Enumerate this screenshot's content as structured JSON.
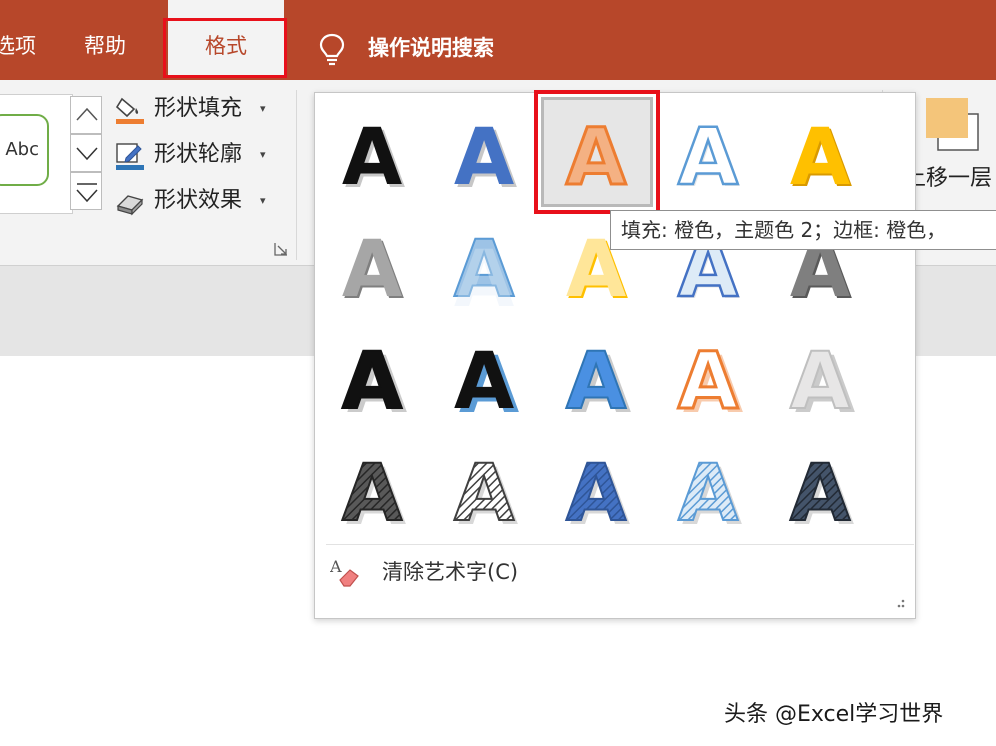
{
  "tabs": {
    "partial_label": "选项",
    "help_label": "帮助",
    "format_label": "格式",
    "tell_me_label": "操作说明搜索"
  },
  "ribbon": {
    "shape_style_sample": "Abc",
    "shape_fill_label": "形状填充",
    "shape_outline_label": "形状轮廓",
    "shape_effects_label": "形状效果",
    "caret": "▾",
    "bring_forward_label": "上移一层",
    "bring_forward_more": "▾"
  },
  "wordart_gallery": {
    "items": [
      {
        "name": "wordart-black-fill",
        "fill": "#111111",
        "outline": "#111111",
        "style": "shadow"
      },
      {
        "name": "wordart-blue-fill",
        "fill": "#4472c4",
        "outline": "#4472c4",
        "style": "shadow"
      },
      {
        "name": "wordart-orange-fill-outline",
        "fill": "#f4b183",
        "outline": "#ed7d31",
        "style": "selected"
      },
      {
        "name": "wordart-white-fill-blue-outline",
        "fill": "#ffffff",
        "outline": "#5b9bd5",
        "style": "outline"
      },
      {
        "name": "wordart-gold-gradient",
        "fill": "#ffc000",
        "outline": "#d99a00",
        "style": "gradient"
      },
      {
        "name": "wordart-gray-gradient",
        "fill": "#a6a6a6",
        "outline": "#7f7f7f",
        "style": "gradient"
      },
      {
        "name": "wordart-blue-reflection",
        "fill": "#9dc3e6",
        "outline": "#5b9bd5",
        "style": "reflection"
      },
      {
        "name": "wordart-yellow-glow",
        "fill": "#ffe699",
        "outline": "#ffc000",
        "style": "gradient"
      },
      {
        "name": "wordart-blue-outline-bevel",
        "fill": "#ddebf7",
        "outline": "#4472c4",
        "style": "outline"
      },
      {
        "name": "wordart-gray-bevel",
        "fill": "#7f7f7f",
        "outline": "#595959",
        "style": "gradient"
      },
      {
        "name": "wordart-black-offset",
        "fill": "#111111",
        "outline": "#111111",
        "style": "offset"
      },
      {
        "name": "wordart-black-blue-offset",
        "fill": "#111111",
        "outline": "#111111",
        "style": "offset-blue"
      },
      {
        "name": "wordart-blue-offset",
        "fill": "#4a90e2",
        "outline": "#2f75b5",
        "style": "offset"
      },
      {
        "name": "wordart-orange-offset",
        "fill": "#ffffff",
        "outline": "#ed7d31",
        "style": "offset-orange"
      },
      {
        "name": "wordart-light-gray-offset",
        "fill": "#e7e6e6",
        "outline": "#bfbfbf",
        "style": "offset"
      },
      {
        "name": "wordart-black-pattern",
        "fill": "#595959",
        "outline": "#262626",
        "style": "pattern"
      },
      {
        "name": "wordart-white-stripe",
        "fill": "#ffffff",
        "outline": "#404040",
        "style": "pattern"
      },
      {
        "name": "wordart-blue-pattern",
        "fill": "#4472c4",
        "outline": "#2f5597",
        "style": "pattern"
      },
      {
        "name": "wordart-light-blue-pattern",
        "fill": "#ddebf7",
        "outline": "#5b9bd5",
        "style": "pattern"
      },
      {
        "name": "wordart-navy-pattern",
        "fill": "#44546a",
        "outline": "#222a35",
        "style": "pattern"
      }
    ],
    "clear_label": "清除艺术字(C)",
    "tooltip": "填充: 橙色，主题色 2；边框: 橙色，"
  },
  "watermark": "头条 @Excel学习世界",
  "colors": {
    "title_bar": "#b7472a",
    "highlight": "#e8101a"
  }
}
